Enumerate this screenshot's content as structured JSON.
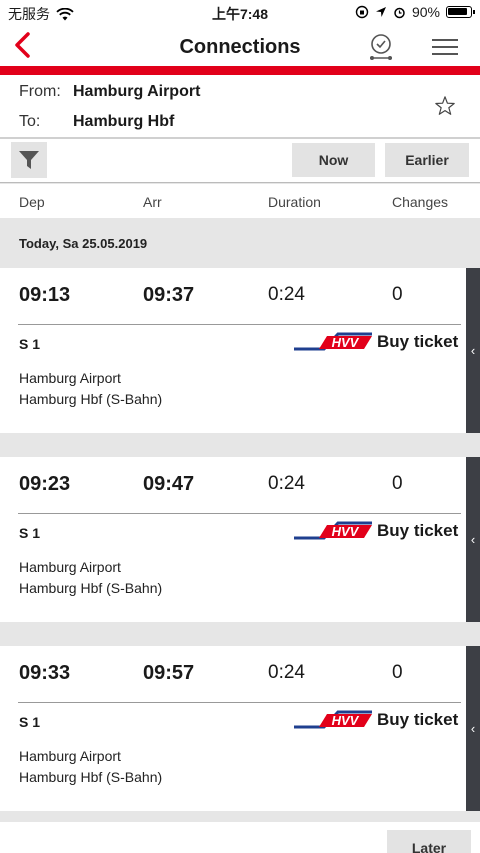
{
  "status_bar": {
    "carrier": "无服务",
    "time": "上午7:48",
    "battery": "90%"
  },
  "nav": {
    "title": "Connections"
  },
  "route": {
    "from_label": "From:",
    "from_value": "Hamburg Airport",
    "to_label": "To:",
    "to_value": "Hamburg Hbf"
  },
  "controls": {
    "now_label": "Now",
    "earlier_label": "Earlier",
    "later_label": "Later"
  },
  "columns": {
    "dep": "Dep",
    "arr": "Arr",
    "duration": "Duration",
    "changes": "Changes"
  },
  "date_header": "Today, Sa 25.05.2019",
  "connections": [
    {
      "dep": "09:13",
      "arr": "09:37",
      "duration": "0:24",
      "changes": "0",
      "line": "S 1",
      "buy_label": "Buy ticket",
      "from_stop": "Hamburg Airport",
      "to_stop": "Hamburg Hbf (S-Bahn)"
    },
    {
      "dep": "09:23",
      "arr": "09:47",
      "duration": "0:24",
      "changes": "0",
      "line": "S 1",
      "buy_label": "Buy ticket",
      "from_stop": "Hamburg Airport",
      "to_stop": "Hamburg Hbf (S-Bahn)"
    },
    {
      "dep": "09:33",
      "arr": "09:57",
      "duration": "0:24",
      "changes": "0",
      "line": "S 1",
      "buy_label": "Buy ticket",
      "from_stop": "Hamburg Airport",
      "to_stop": "Hamburg Hbf (S-Bahn)"
    }
  ],
  "logo_text": "HVV",
  "colors": {
    "accent": "#e2001a",
    "hvv_blue": "#1f3f8f",
    "side_tab": "#3d3f45"
  },
  "icons": {
    "back": "chevron-left-icon",
    "alarm": "alarm-clock-icon",
    "menu": "hamburger-menu-icon",
    "favorite": "star-outline-icon",
    "filter": "funnel-icon",
    "expand": "chevron-left-small-icon"
  }
}
